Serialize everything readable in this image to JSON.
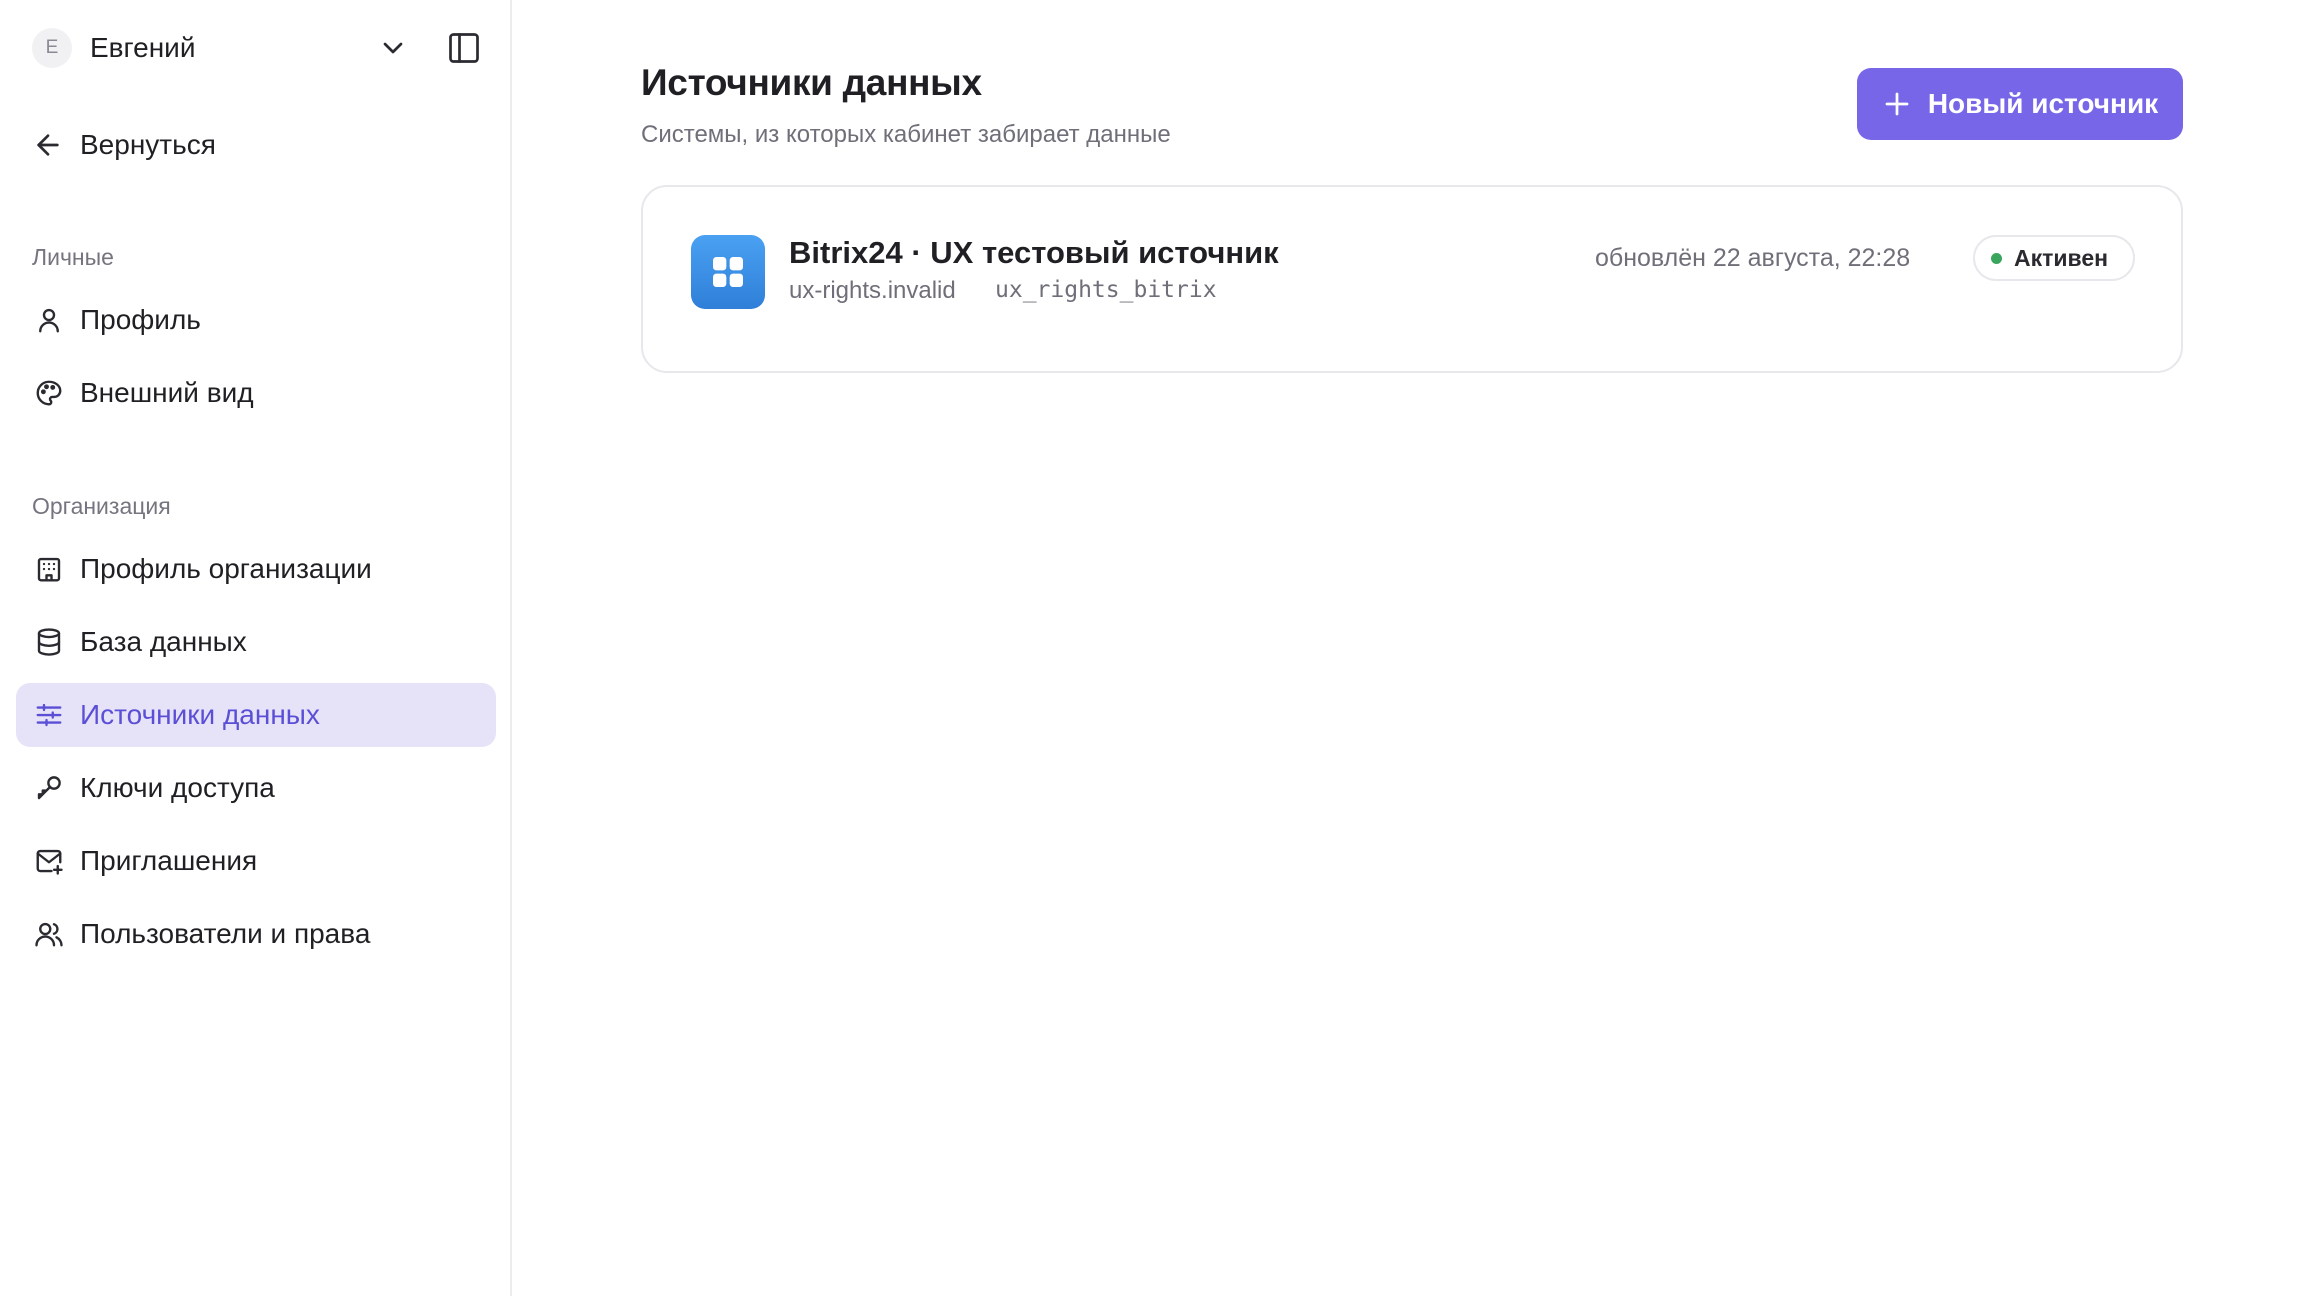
{
  "user": {
    "avatar_initial": "Е",
    "name": "Евгений"
  },
  "sidebar": {
    "back_label": "Вернуться",
    "sections": [
      {
        "title": "Личные"
      },
      {
        "title": "Организация"
      }
    ],
    "items": [
      {
        "label": "Профиль",
        "icon": "user-icon"
      },
      {
        "label": "Внешний вид",
        "icon": "palette-icon"
      },
      {
        "label": "Профиль организации",
        "icon": "building-icon"
      },
      {
        "label": "База данных",
        "icon": "database-icon"
      },
      {
        "label": "Источники данных",
        "icon": "sliders-icon",
        "active": true
      },
      {
        "label": "Ключи доступа",
        "icon": "key-icon"
      },
      {
        "label": "Приглашения",
        "icon": "mail-plus-icon"
      },
      {
        "label": "Пользователи и права",
        "icon": "users-icon"
      }
    ]
  },
  "main": {
    "title": "Источники данных",
    "subtitle": "Системы, из которых кабинет забирает данные",
    "new_button_label": "Новый источник",
    "sources": [
      {
        "name": "Bitrix24 · UX тестовый источник",
        "domain": "ux-rights.invalid",
        "key": "ux_rights_bitrix",
        "updated": "обновлён 22 августа, 22:28",
        "status": "Активен",
        "icon": "bitrix-grid-icon"
      }
    ]
  },
  "colors": {
    "accent": "#7767e8",
    "active_bg": "#e6e3f9",
    "active_text": "#5b4fd6",
    "status_active": "#3aa55d",
    "source_icon": "#3a8ee6"
  }
}
